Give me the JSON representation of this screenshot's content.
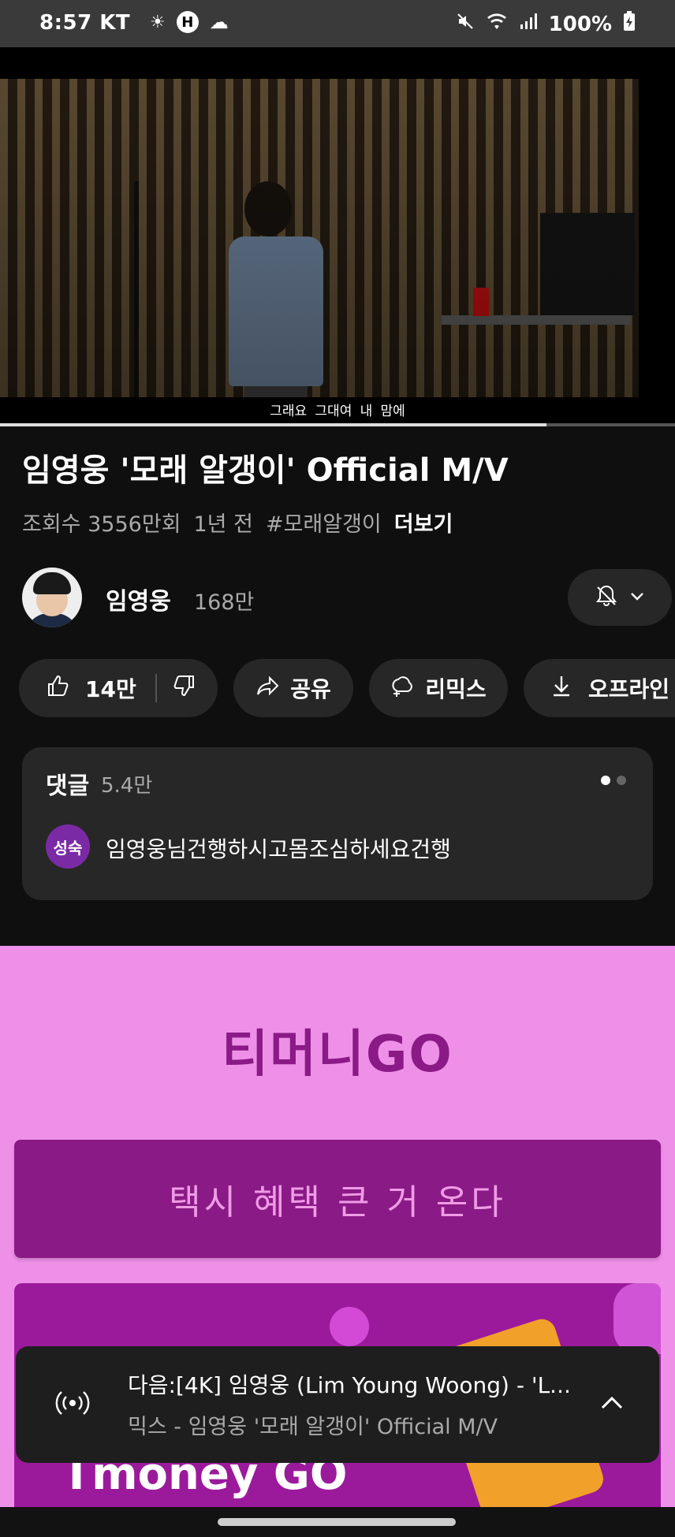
{
  "status_bar": {
    "time": "8:57",
    "carrier": "KT",
    "h_badge": "H",
    "battery": "100%",
    "icons": [
      "weather-icon",
      "cloud-icon",
      "mute-icon",
      "wifi-icon",
      "signal-icon",
      "battery-charging-icon"
    ]
  },
  "video": {
    "caption": "그래요 그대여 내 맘에",
    "progress": 0.81
  },
  "info": {
    "title": "임영웅 '모래 알갱이' Official M/V",
    "views": "조회수 3556만회",
    "age": "1년 전",
    "hashtag": "#모래알갱이",
    "more": "더보기"
  },
  "channel": {
    "name": "임영웅",
    "subscribers": "168만",
    "bell_icon": "bell-off-icon"
  },
  "actions": {
    "like_count": "14만",
    "share": "공유",
    "remix": "리믹스",
    "offline": "오프라인"
  },
  "comments": {
    "header": "댓글",
    "count": "5.4만",
    "avatar_text": "성숙",
    "first_comment": "임영웅님건행하시고몸조심하세요건행"
  },
  "ad": {
    "brand": "티머니GO",
    "cta": "택시 혜택 큰 거 온다",
    "banner_text": "Tmoney GO",
    "colors": {
      "background": "#ee90e8",
      "primary": "#8a1a86",
      "cta_text": "#f09be6"
    }
  },
  "next": {
    "line1": "다음:[4K] 임영웅 (Lim Young Woong) - 'L...",
    "line2": "믹스 - 임영웅 '모래 알갱이' Official M/V"
  }
}
